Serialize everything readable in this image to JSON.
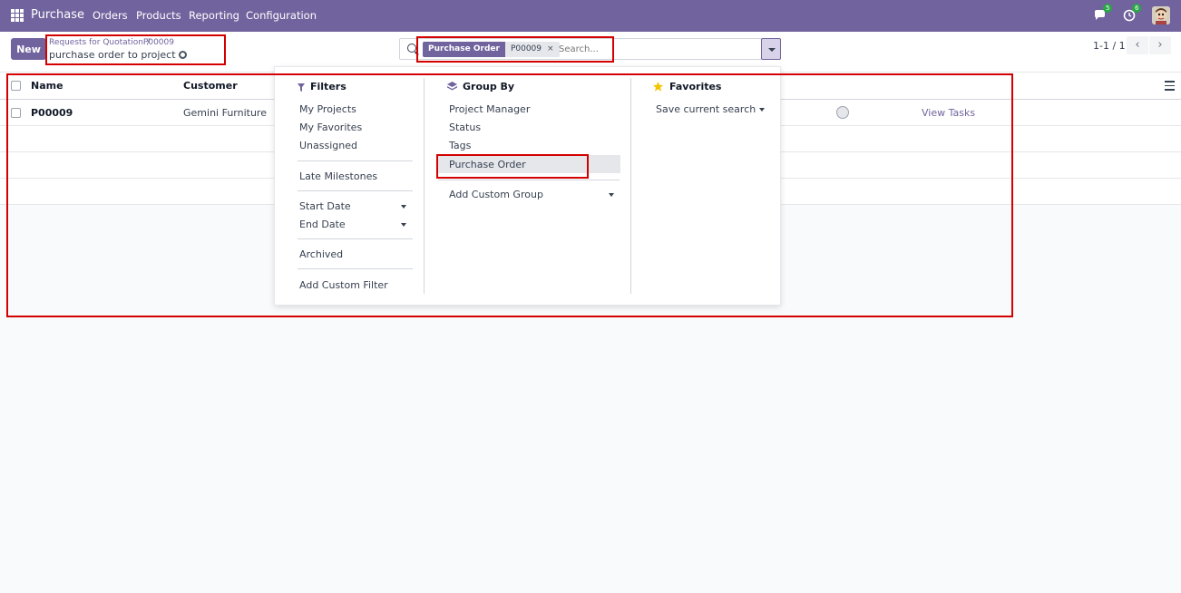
{
  "navbar": {
    "app_name": "Purchase",
    "menu": [
      "Orders",
      "Products",
      "Reporting",
      "Configuration"
    ],
    "messages_count": "5",
    "activities_count": "6",
    "accent": "#71639e"
  },
  "control_panel": {
    "new_label": "New",
    "breadcrumb": [
      "Requests for Quotation",
      "P00009"
    ],
    "breadcrumb_sep": "/",
    "record_title": "purchase order to project",
    "search": {
      "facet_label": "Purchase Order",
      "facet_value": "P00009",
      "facet_remove": "×",
      "placeholder": "Search..."
    },
    "pager": "1-1 / 1",
    "prev_icon": "‹",
    "next_icon": "›"
  },
  "table": {
    "headers": [
      "Name",
      "Customer"
    ],
    "rows": [
      {
        "name": "P00009",
        "customer": "Gemini Furniture",
        "action": "View Tasks"
      }
    ]
  },
  "dropdown": {
    "filters": {
      "title": "Filters",
      "group1": [
        "My Projects",
        "My Favorites",
        "Unassigned"
      ],
      "group2": [
        "Late Milestones"
      ],
      "group3": [
        "Start Date",
        "End Date"
      ],
      "group4": [
        "Archived"
      ],
      "custom": "Add Custom Filter"
    },
    "group_by": {
      "title": "Group By",
      "items": [
        "Project Manager",
        "Status",
        "Tags",
        "Purchase Order"
      ],
      "custom": "Add Custom Group"
    },
    "favorites": {
      "title": "Favorites",
      "save": "Save current search"
    }
  }
}
